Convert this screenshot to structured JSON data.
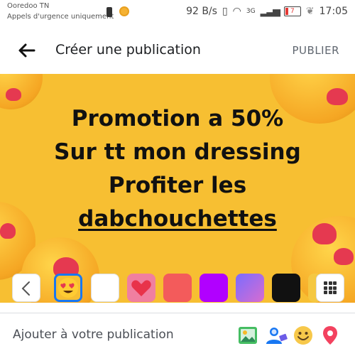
{
  "status_bar": {
    "carrier": "Ooredoo TN",
    "emergency": "Appels d'urgence uniquement",
    "speed": "92 B/s",
    "network": "3G",
    "battery": "7",
    "time": "17:05"
  },
  "header": {
    "title": "Créer une publication",
    "publish_label": "PUBLIER"
  },
  "post": {
    "line1": "Promotion a 50%",
    "line2": "Sur tt mon dressing",
    "line3": "Profiter les",
    "line4": "dabchouchettes"
  },
  "backgrounds": {
    "colors": [
      "#ffffff",
      "#f35b5b",
      "#b100ff",
      "#111111"
    ],
    "selected": "emoji"
  },
  "bottom_bar": {
    "label": "Ajouter à votre publication",
    "icons": [
      "photo-icon",
      "tag-people-icon",
      "feeling-emoji-icon",
      "location-pin-icon"
    ]
  }
}
